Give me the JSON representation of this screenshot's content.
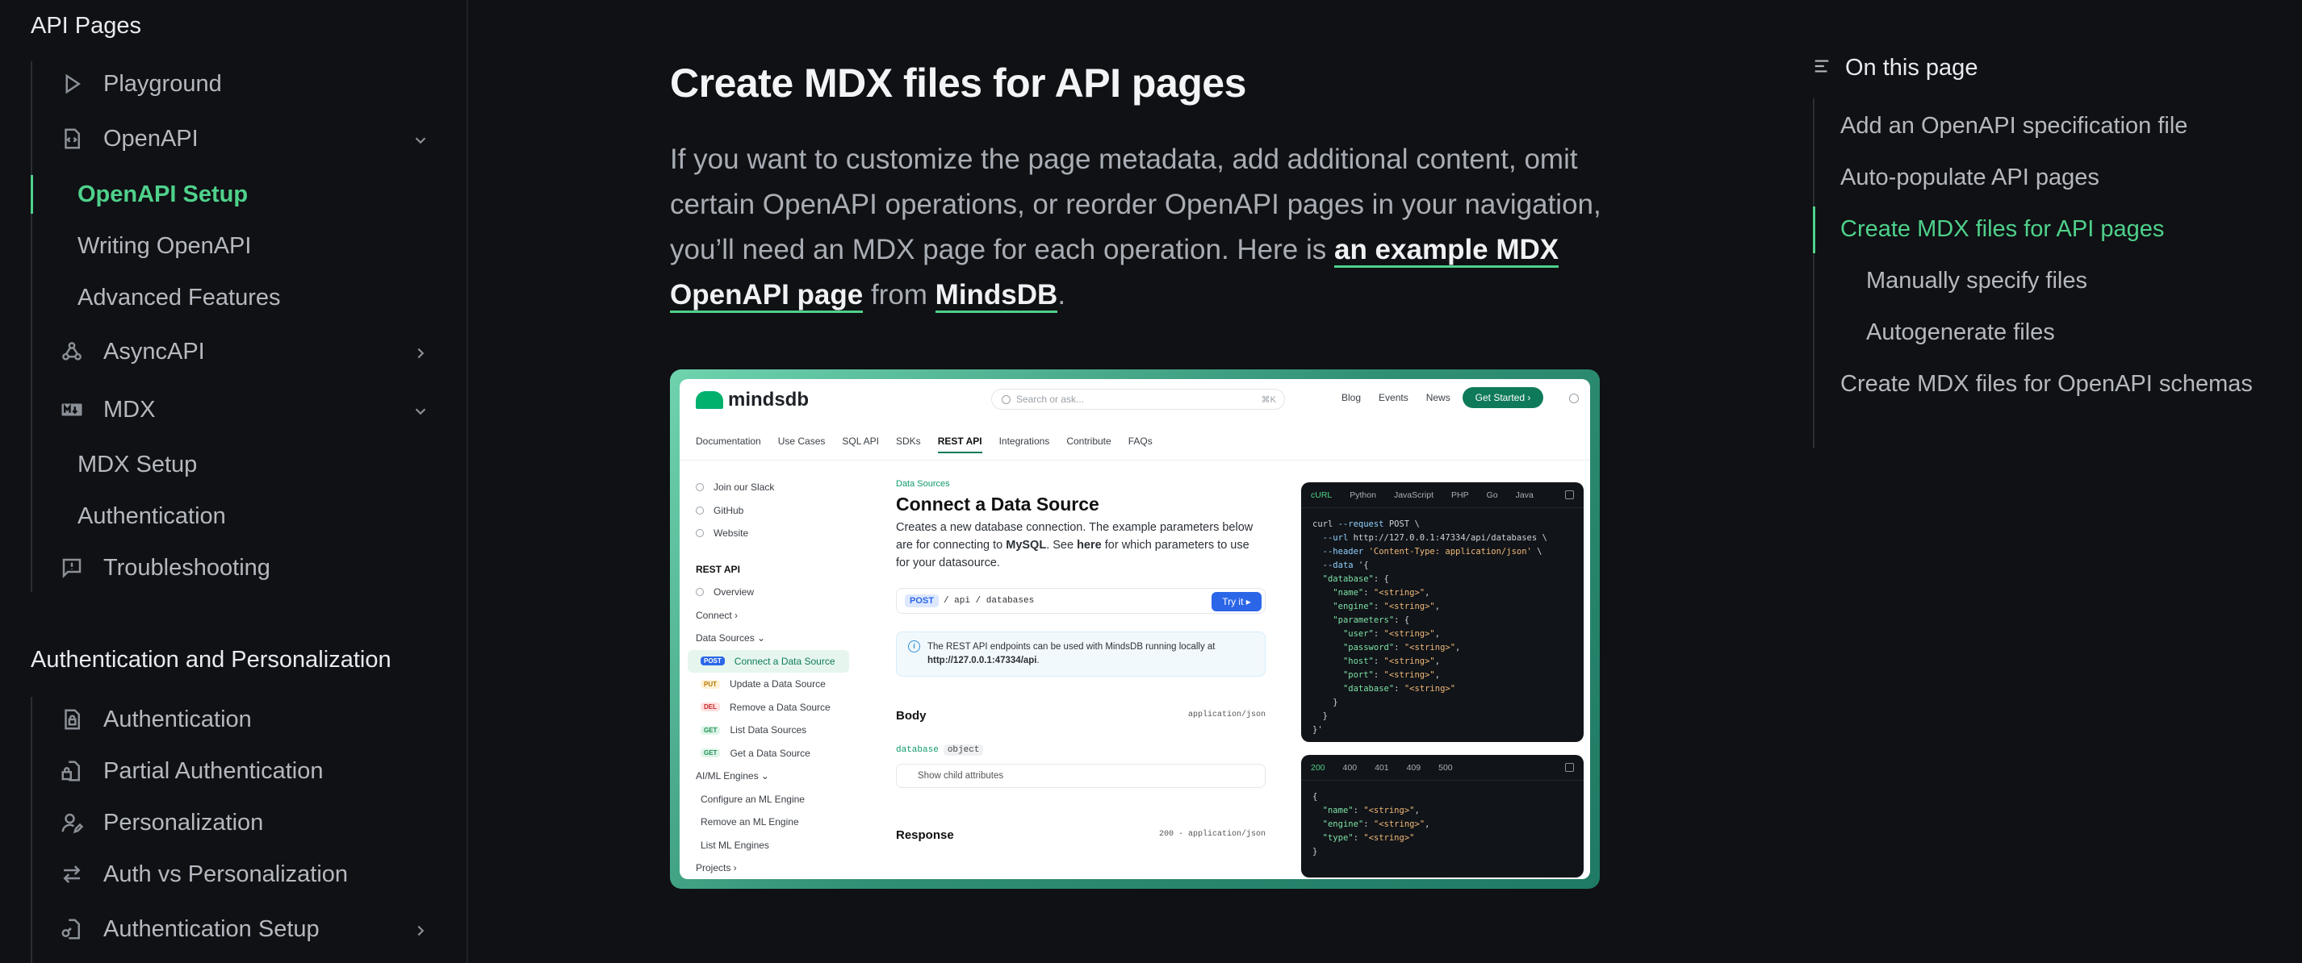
{
  "sidebar": {
    "group1_title": "API Pages",
    "items": [
      {
        "label": "Playground"
      },
      {
        "label": "OpenAPI"
      },
      {
        "label": "OpenAPI Setup"
      },
      {
        "label": "Writing OpenAPI"
      },
      {
        "label": "Advanced Features"
      },
      {
        "label": "AsyncAPI"
      },
      {
        "label": "MDX"
      },
      {
        "label": "MDX Setup"
      },
      {
        "label": "Authentication"
      },
      {
        "label": "Troubleshooting"
      }
    ],
    "group2_title": "Authentication and Personalization",
    "items2": [
      {
        "label": "Authentication"
      },
      {
        "label": "Partial Authentication"
      },
      {
        "label": "Personalization"
      },
      {
        "label": "Auth vs Personalization"
      },
      {
        "label": "Authentication Setup"
      }
    ]
  },
  "main": {
    "title": "Create MDX files for API pages",
    "intro_text": "If you want to customize the page metadata, add additional content, omit certain OpenAPI operations, or reorder OpenAPI pages in your navigation, you’ll need an MDX page for each operation. Here is ",
    "link1": "an example MDX OpenAPI page",
    "mid_text": " from ",
    "link2": "MindsDB",
    "end_text": "."
  },
  "example": {
    "logo": "mindsdb",
    "search_placeholder": "Search or ask...",
    "search_kbd": "⌘K",
    "top_links": [
      "Blog",
      "Events",
      "News"
    ],
    "get_started": "Get Started ›",
    "tabs": [
      "Documentation",
      "Use Cases",
      "SQL API",
      "SDKs",
      "REST API",
      "Integrations",
      "Contribute",
      "FAQs"
    ],
    "side": {
      "links": [
        "Join our Slack",
        "GitHub",
        "Website"
      ],
      "section": "REST API",
      "overview": "Overview",
      "connect": "Connect ›",
      "data_sources": "Data Sources ⌄",
      "endpoints": [
        {
          "method": "POST",
          "label": "Connect a Data Source"
        },
        {
          "method": "PUT",
          "label": "Update a Data Source"
        },
        {
          "method": "DEL",
          "label": "Remove a Data Source"
        },
        {
          "method": "GET",
          "label": "List Data Sources"
        },
        {
          "method": "GET",
          "label": "Get a Data Source"
        }
      ],
      "engines": "AI/ML Engines ⌄",
      "engine_items": [
        "Configure an ML Engine",
        "Remove an ML Engine",
        "List ML Engines"
      ],
      "projects": "Projects ›"
    },
    "crumb": "Data Sources",
    "h1": "Connect a Data Source",
    "desc_a": "Creates a new database connection. The example parameters below are for connecting to ",
    "desc_b": "MySQL",
    "desc_c": ". See ",
    "desc_d": "here",
    "desc_e": " for which parameters to use for your datasource.",
    "method": "POST",
    "path": "/ api / databases",
    "try_it": "Try it ▸",
    "info_a": "The REST API endpoints can be used with MindsDB running locally at ",
    "info_b": "http://127.0.0.1:47334/api",
    "info_c": ".",
    "body_label": "Body",
    "body_type": "application/json",
    "field_name": "database",
    "field_type": "object",
    "child_attrs": "Show child attributes",
    "response_label": "Response",
    "response_type": "200 - application/json",
    "code_tabs": [
      "cURL",
      "Python",
      "JavaScript",
      "PHP",
      "Go",
      "Java"
    ],
    "resp_tabs": [
      "200",
      "400",
      "401",
      "409",
      "500"
    ]
  },
  "toc": {
    "header": "On this page",
    "items": [
      "Add an OpenAPI specification file",
      "Auto-populate API pages",
      "Create MDX files for API pages",
      "Manually specify files",
      "Autogenerate files",
      "Create MDX files for OpenAPI schemas"
    ]
  },
  "colors": {
    "accent": "#4fd18b",
    "background": "#0f1114"
  }
}
